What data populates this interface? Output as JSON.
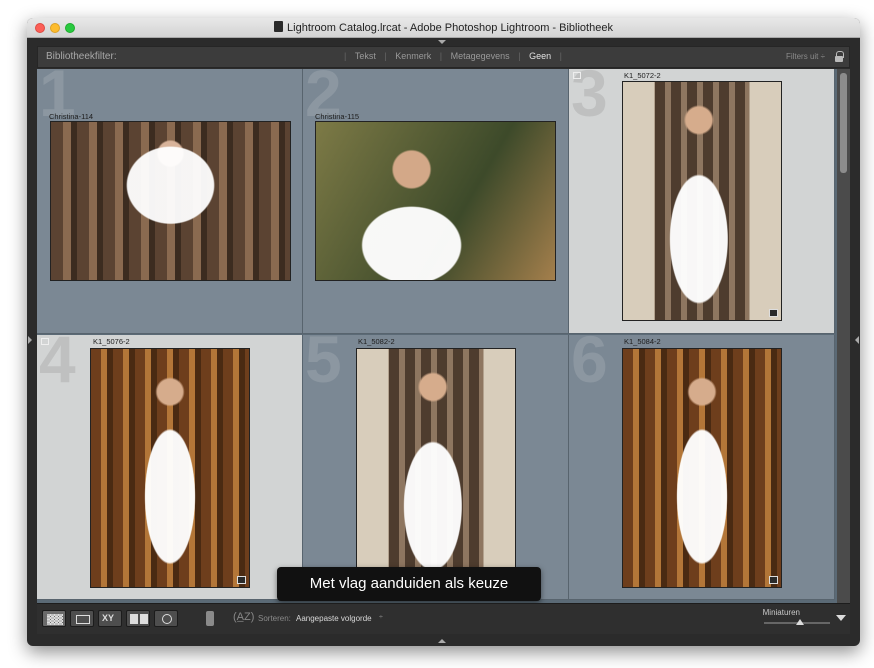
{
  "window": {
    "title": "Lightroom Catalog.lrcat - Adobe Photoshop Lightroom - Bibliotheek"
  },
  "filter_bar": {
    "label": "Bibliotheekfilter:",
    "tabs": [
      "Tekst",
      "Kenmerk",
      "Metagegevens",
      "Geen"
    ],
    "active_tab": "Geen",
    "filters_off": "Filters uit ÷"
  },
  "grid": {
    "cells": [
      {
        "index": "1",
        "name": "Christina-114",
        "selected": false,
        "flagged": false
      },
      {
        "index": "2",
        "name": "Christina-115",
        "selected": false,
        "flagged": false
      },
      {
        "index": "3",
        "name": "K1_5072-2",
        "selected": true,
        "flagged": true
      },
      {
        "index": "4",
        "name": "K1_5076-2",
        "selected": true,
        "flagged": true
      },
      {
        "index": "5",
        "name": "K1_5082-2",
        "selected": false,
        "flagged": false
      },
      {
        "index": "6",
        "name": "K1_5084-2",
        "selected": false,
        "flagged": false
      }
    ]
  },
  "tooltip": {
    "text": "Met vlag aanduiden als keuze"
  },
  "toolbar": {
    "view_buttons": [
      "grid-view-icon",
      "loupe-view-icon",
      "compare-view-icon",
      "survey-view-icon",
      "people-view-icon"
    ],
    "compare_label": "XY",
    "sort_label": "Sorteren:",
    "sort_value": "Aangepaste volgorde",
    "sort_chevron": "÷",
    "thumbnail_label": "Miniaturen",
    "thumbnail_size": 0.55
  }
}
